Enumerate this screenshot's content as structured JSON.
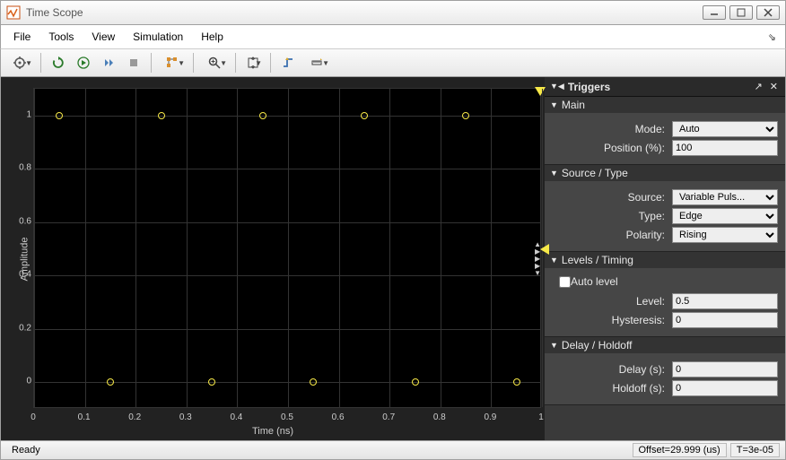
{
  "window": {
    "title": "Time Scope"
  },
  "menu": {
    "file": "File",
    "tools": "Tools",
    "view": "View",
    "simulation": "Simulation",
    "help": "Help"
  },
  "axes": {
    "xlabel": "Time (ns)",
    "ylabel": "Amplitude",
    "xticks": [
      "0",
      "0.1",
      "0.2",
      "0.3",
      "0.4",
      "0.5",
      "0.6",
      "0.7",
      "0.8",
      "0.9",
      "1"
    ],
    "yticks": [
      "0",
      "0.2",
      "0.4",
      "0.6",
      "0.8",
      "1"
    ]
  },
  "chart_data": {
    "type": "scatter",
    "xlabel": "Time (ns)",
    "ylabel": "Amplitude",
    "xlim": [
      0,
      1
    ],
    "ylim": [
      -0.1,
      1.1
    ],
    "series": [
      {
        "name": "Variable Pulse",
        "x": [
          0.05,
          0.15,
          0.25,
          0.35,
          0.45,
          0.55,
          0.65,
          0.75,
          0.85,
          0.95
        ],
        "y": [
          1,
          0,
          1,
          0,
          1,
          0,
          1,
          0,
          1,
          0
        ],
        "marker": "open-circle",
        "color": "#f7e948"
      }
    ],
    "trigger_level": 0.5,
    "trigger_position_pct": 100
  },
  "triggers": {
    "title": "Triggers",
    "sections": {
      "main": {
        "title": "Main",
        "mode_label": "Mode:",
        "mode_value": "Auto",
        "position_label": "Position (%):",
        "position_value": "100"
      },
      "source": {
        "title": "Source / Type",
        "source_label": "Source:",
        "source_value": "Variable Puls...",
        "type_label": "Type:",
        "type_value": "Edge",
        "polarity_label": "Polarity:",
        "polarity_value": "Rising"
      },
      "levels": {
        "title": "Levels / Timing",
        "auto_label": "Auto level",
        "level_label": "Level:",
        "level_value": "0.5",
        "hyst_label": "Hysteresis:",
        "hyst_value": "0"
      },
      "delay": {
        "title": "Delay / Holdoff",
        "delay_label": "Delay (s):",
        "delay_value": "0",
        "holdoff_label": "Holdoff (s):",
        "holdoff_value": "0"
      }
    }
  },
  "status": {
    "ready": "Ready",
    "offset": "Offset=29.999 (us)",
    "t": "T=3e-05"
  }
}
